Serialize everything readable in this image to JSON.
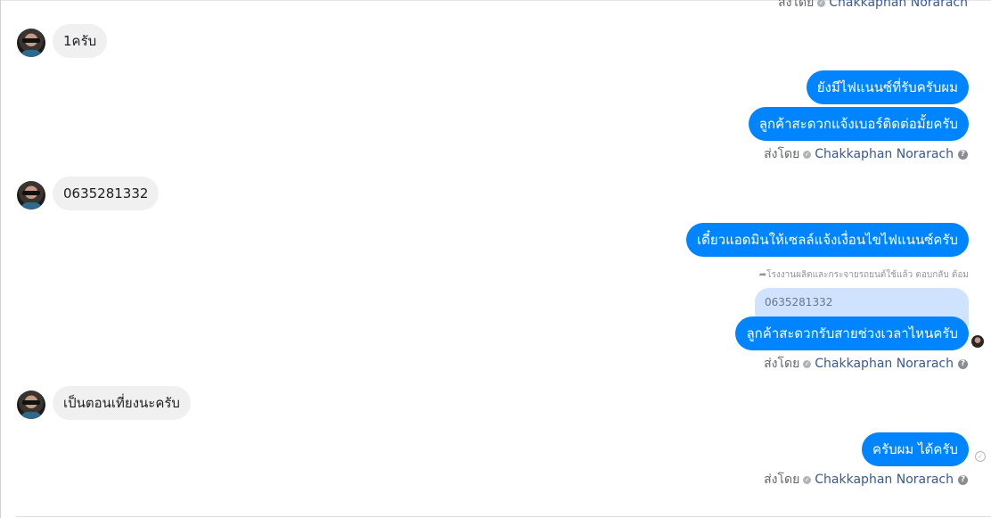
{
  "sender_name": "Chakkaphan Norarach",
  "sent_by_label": "ส่งโดย",
  "verified_icon": "check-circle-icon",
  "help_icon": "question-circle-icon",
  "help_glyph": "?",
  "messages": {
    "in_1": "1ครับ",
    "out_1": "ยังมีไฟแนนซ์ที่รับครับผม",
    "out_2": "ลูกค้าสะดวกแจ้งเบอร์ติดต่อมั้ยครับ",
    "in_2": "0635281332",
    "out_3": "เดี๋ยวแอดมินให้เซลล์แจ้งเงื่อนไขไฟแนนซ์ครับ",
    "reply_note": "โรงงานผลิตและกระจายรถยนต์ใช้แล้ว ตอบกลับ ต้อม",
    "quoted_text": "0635281332",
    "out_4": "ลูกค้าสะดวกรับสายช่วงเวลาไหนครับ",
    "in_3": "เป็นตอนเที่ยงนะครับ",
    "out_5": "ครับผม ได้ครับ"
  },
  "colors": {
    "outgoing_bubble": "#0084ff",
    "incoming_bubble": "#f0f0f0",
    "quoted_bubble": "#cfe3ff",
    "sender_link": "#385898"
  }
}
